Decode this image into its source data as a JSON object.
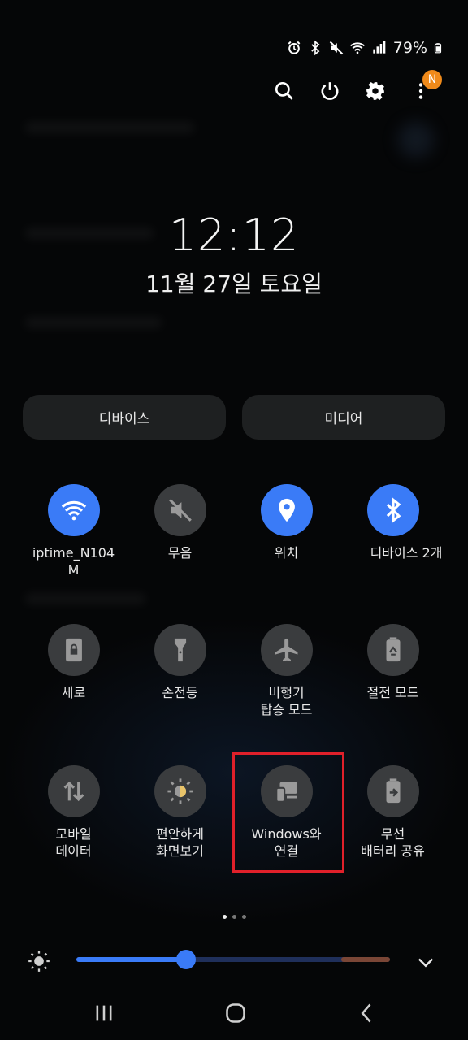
{
  "status_bar": {
    "battery_percent": "79%",
    "icons": [
      "alarm-icon",
      "bluetooth-icon",
      "mute-icon",
      "wifi-icon",
      "signal-icon",
      "battery-icon"
    ]
  },
  "top_actions": {
    "icons": [
      "search-icon",
      "power-icon",
      "gear-icon",
      "more-icon"
    ],
    "notification_badge": "N"
  },
  "clock": {
    "time": "12:12",
    "date": "11월 27일 토요일"
  },
  "pills": {
    "device": "디바이스",
    "media": "미디어"
  },
  "tiles": [
    {
      "label": "iptime_N104\nM",
      "icon": "wifi-icon",
      "active": true
    },
    {
      "label": "무음",
      "icon": "mute-icon",
      "active": false
    },
    {
      "label": "위치",
      "icon": "location-icon",
      "active": true
    },
    {
      "label": "디바이스 2개",
      "icon": "bluetooth-icon",
      "active": true
    },
    {
      "label": "세로",
      "icon": "portrait-lock-icon",
      "active": false
    },
    {
      "label": "손전등",
      "icon": "flashlight-icon",
      "active": false
    },
    {
      "label": "비행기\n탑승 모드",
      "icon": "airplane-icon",
      "active": false
    },
    {
      "label": "절전 모드",
      "icon": "battery-saver-icon",
      "active": false
    },
    {
      "label": "모바일\n데이터",
      "icon": "mobile-data-icon",
      "active": false
    },
    {
      "label": "편안하게\n화면보기",
      "icon": "eye-comfort-icon",
      "active": false
    },
    {
      "label": "Windows와\n연결",
      "icon": "link-to-windows-icon",
      "active": false
    },
    {
      "label": "무선\n배터리 공유",
      "icon": "wireless-powershare-icon",
      "active": false
    }
  ],
  "page_indicator": {
    "count": 3,
    "active_index": 0
  },
  "brightness": {
    "level": 0.35
  },
  "colors": {
    "accent": "#3a7bf7",
    "tile_off": "#3a3c3e",
    "highlight": "#e0202a",
    "badge": "#f08a1a"
  },
  "nav": {
    "icons": [
      "recent-apps-icon",
      "home-icon",
      "back-icon"
    ]
  }
}
